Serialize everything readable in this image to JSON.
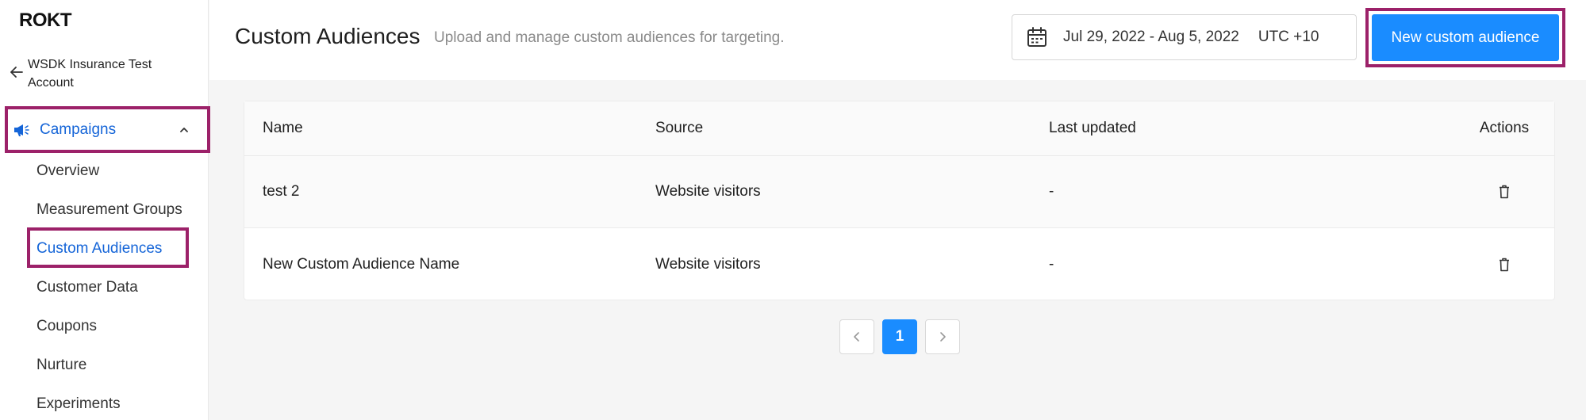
{
  "brand": {
    "logo_text": "ROKT"
  },
  "sidebar": {
    "account_name": "WSDK Insurance Test Account",
    "campaigns_label": "Campaigns",
    "items": [
      {
        "label": "Overview"
      },
      {
        "label": "Measurement Groups"
      },
      {
        "label": "Custom Audiences",
        "active": true
      },
      {
        "label": "Customer Data"
      },
      {
        "label": "Coupons"
      },
      {
        "label": "Nurture"
      },
      {
        "label": "Experiments"
      }
    ]
  },
  "header": {
    "title": "Custom Audiences",
    "subtitle": "Upload and manage custom audiences for targeting.",
    "date_range": "Jul 29, 2022 - Aug 5, 2022",
    "timezone": "UTC +10",
    "new_button_label": "New custom audience"
  },
  "table": {
    "columns": [
      "Name",
      "Source",
      "Last updated",
      "Actions"
    ],
    "rows": [
      {
        "name": "test 2",
        "source": "Website visitors",
        "last_updated": "-"
      },
      {
        "name": "New Custom Audience Name",
        "source": "Website visitors",
        "last_updated": "-"
      }
    ]
  },
  "pagination": {
    "current_page": "1"
  },
  "colors": {
    "accent": "#1a8cff",
    "link": "#1565d8",
    "highlight_border": "#9c2169"
  },
  "icons": [
    "back-arrow-icon",
    "megaphone-icon",
    "chevron-up-icon",
    "calendar-icon",
    "trash-icon",
    "chevron-left-icon",
    "chevron-right-icon"
  ]
}
